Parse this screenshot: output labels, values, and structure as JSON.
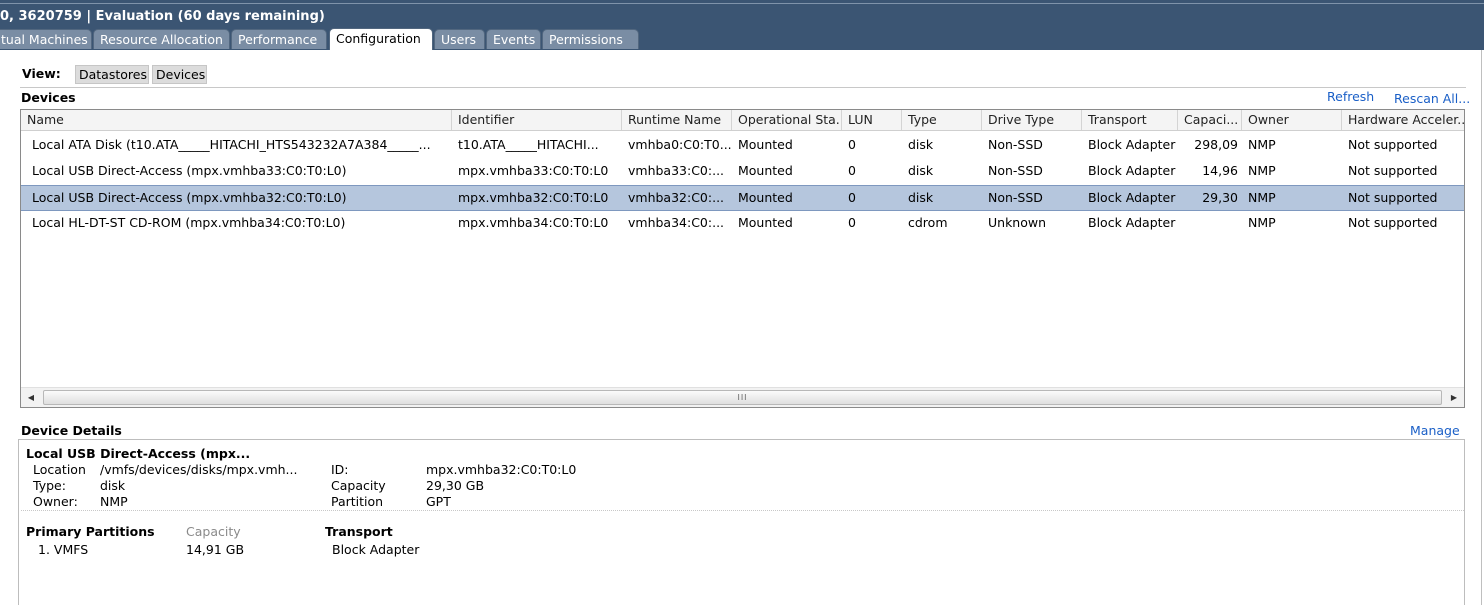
{
  "window": {
    "title": "0, 3620759 | Evaluation (60 days remaining)"
  },
  "tabs": [
    {
      "label": "tual Machines"
    },
    {
      "label": "Resource Allocation"
    },
    {
      "label": "Performance"
    },
    {
      "label": "Configuration"
    },
    {
      "label": "Users"
    },
    {
      "label": "Events"
    },
    {
      "label": "Permissions"
    }
  ],
  "view": {
    "label": "View:",
    "datastores_label": "Datastores",
    "devices_label": "Devices"
  },
  "devices_section": {
    "title": "Devices",
    "refresh_label": "Refresh",
    "rescan_label": "Rescan All..."
  },
  "table": {
    "columns": [
      "Name",
      "Identifier",
      "Runtime Name",
      "Operational Sta...",
      "LUN",
      "Type",
      "Drive Type",
      "Transport",
      "Capaci...",
      "Owner",
      "Hardware Acceler..."
    ],
    "rows": [
      {
        "name": "Local ATA Disk (t10.ATA_____HITACHI_HTS543232A7A384_____...",
        "identifier": "t10.ATA_____HITACHI...",
        "runtime": "vmhba0:C0:T0...",
        "status": "Mounted",
        "lun": "0",
        "type": "disk",
        "drive_type": "Non-SSD",
        "transport": "Block Adapter",
        "capacity": "298,09",
        "owner": "NMP",
        "hw_accel": "Not supported"
      },
      {
        "name": "Local USB Direct-Access (mpx.vmhba33:C0:T0:L0)",
        "identifier": "mpx.vmhba33:C0:T0:L0",
        "runtime": "vmhba33:C0:...",
        "status": "Mounted",
        "lun": "0",
        "type": "disk",
        "drive_type": "Non-SSD",
        "transport": "Block Adapter",
        "capacity": "14,96",
        "owner": "NMP",
        "hw_accel": "Not supported"
      },
      {
        "name": "Local USB Direct-Access (mpx.vmhba32:C0:T0:L0)",
        "identifier": "mpx.vmhba32:C0:T0:L0",
        "runtime": "vmhba32:C0:...",
        "status": "Mounted",
        "lun": "0",
        "type": "disk",
        "drive_type": "Non-SSD",
        "transport": "Block Adapter",
        "capacity": "29,30",
        "owner": "NMP",
        "hw_accel": "Not supported",
        "selected": true
      },
      {
        "name": "Local HL-DT-ST CD-ROM (mpx.vmhba34:C0:T0:L0)",
        "identifier": "mpx.vmhba34:C0:T0:L0",
        "runtime": "vmhba34:C0:...",
        "status": "Mounted",
        "lun": "0",
        "type": "cdrom",
        "drive_type": "Unknown",
        "transport": "Block Adapter",
        "capacity": "",
        "owner": "NMP",
        "hw_accel": "Not supported"
      }
    ],
    "scrollbar": {
      "grip": "III"
    }
  },
  "details": {
    "title": "Device Details",
    "manage_label": "Manage",
    "device_name": "Local USB Direct-Access (mpx...",
    "location_label": "Location",
    "location_value": "/vmfs/devices/disks/mpx.vmh...",
    "type_label": "Type:",
    "type_value": "disk",
    "owner_label": "Owner:",
    "owner_value": "NMP",
    "id_label": "ID:",
    "id_value": "mpx.vmhba32:C0:T0:L0",
    "capacity_label": "Capacity",
    "capacity_value": "29,30 GB",
    "partition_label": "Partition",
    "partition_value": "GPT",
    "primary_partitions_label": "Primary Partitions",
    "partition_capacity_label": "Capacity",
    "transport_label": "Transport",
    "partitions": [
      {
        "name": "1. VMFS",
        "capacity": "14,91 GB",
        "transport": "Block Adapter"
      }
    ]
  },
  "colors": {
    "header_bg": "#3b5573",
    "selected_row": "#b5c6dd",
    "link": "#1a5fc7"
  }
}
